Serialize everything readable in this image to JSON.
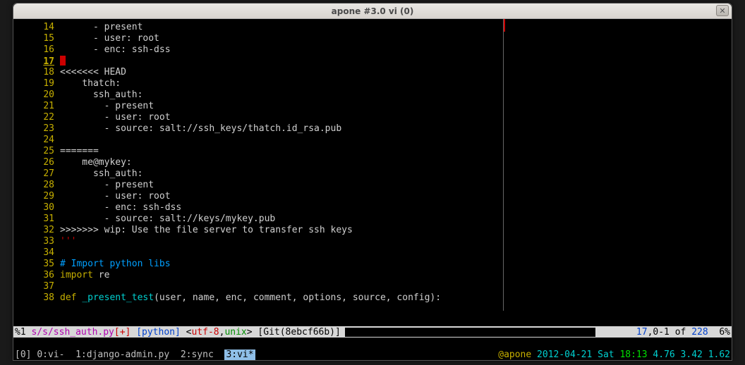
{
  "title": "apone  #3.0  vi (0)",
  "code": {
    "lines": [
      {
        "n": 14,
        "segs": [
          {
            "cls": "txt",
            "t": "      - present"
          }
        ]
      },
      {
        "n": 15,
        "segs": [
          {
            "cls": "txt",
            "t": "      - user: root"
          }
        ]
      },
      {
        "n": 16,
        "segs": [
          {
            "cls": "txt",
            "t": "      - enc: ssh-dss"
          }
        ]
      },
      {
        "n": 17,
        "cursor": true,
        "segs": []
      },
      {
        "n": 18,
        "segs": [
          {
            "cls": "txt",
            "t": "<<<<<<< HEAD"
          }
        ]
      },
      {
        "n": 19,
        "segs": [
          {
            "cls": "txt",
            "t": "    thatch:"
          }
        ]
      },
      {
        "n": 20,
        "segs": [
          {
            "cls": "txt",
            "t": "      ssh_auth:"
          }
        ]
      },
      {
        "n": 21,
        "segs": [
          {
            "cls": "txt",
            "t": "        - present"
          }
        ]
      },
      {
        "n": 22,
        "segs": [
          {
            "cls": "txt",
            "t": "        - user: root"
          }
        ]
      },
      {
        "n": 23,
        "segs": [
          {
            "cls": "txt",
            "t": "        - source: salt://ssh_keys/thatch.id_rsa.pub"
          }
        ]
      },
      {
        "n": 24,
        "segs": []
      },
      {
        "n": 25,
        "segs": [
          {
            "cls": "txt",
            "t": "======="
          }
        ]
      },
      {
        "n": 26,
        "segs": [
          {
            "cls": "txt",
            "t": "    me@mykey:"
          }
        ]
      },
      {
        "n": 27,
        "segs": [
          {
            "cls": "txt",
            "t": "      ssh_auth:"
          }
        ]
      },
      {
        "n": 28,
        "segs": [
          {
            "cls": "txt",
            "t": "        - present"
          }
        ]
      },
      {
        "n": 29,
        "segs": [
          {
            "cls": "txt",
            "t": "        - user: root"
          }
        ]
      },
      {
        "n": 30,
        "segs": [
          {
            "cls": "txt",
            "t": "        - enc: ssh-dss"
          }
        ]
      },
      {
        "n": 31,
        "segs": [
          {
            "cls": "txt",
            "t": "        - source: salt://keys/mykey.pub"
          }
        ]
      },
      {
        "n": 32,
        "segs": [
          {
            "cls": "txt",
            "t": ">>>>>>> wip: Use the file server to transfer ssh keys"
          }
        ]
      },
      {
        "n": 33,
        "segs": [
          {
            "cls": "str",
            "t": "'''"
          }
        ]
      },
      {
        "n": 34,
        "segs": []
      },
      {
        "n": 35,
        "segs": [
          {
            "cls": "cmt",
            "t": "# Import python libs"
          }
        ]
      },
      {
        "n": 36,
        "segs": [
          {
            "cls": "kw",
            "t": "import"
          },
          {
            "cls": "txt",
            "t": " re"
          }
        ]
      },
      {
        "n": 37,
        "segs": []
      },
      {
        "n": 38,
        "segs": [
          {
            "cls": "kw",
            "t": "def "
          },
          {
            "cls": "fn",
            "t": "_present_test"
          },
          {
            "cls": "txt",
            "t": "(user, name, enc, comment, options, source, config):"
          }
        ]
      }
    ]
  },
  "status": {
    "pct": "%1",
    "path": "s/s/ssh_auth.py",
    "modified": "[+]",
    "ftype": "[python]",
    "enc_open": "<",
    "enc_a": "utf-8",
    "enc_sep": ",",
    "enc_b": "unix",
    "enc_close": ">",
    "git": "[Git(8ebcf66b)]",
    "pos_a": "17",
    "pos_b": ",0-1",
    "of": " of ",
    "total": "228",
    "tail": "  6%"
  },
  "tmux": {
    "session": "[0]",
    "w0": "0:vi-",
    "w1": "1:django-admin.py",
    "w2": "2:sync",
    "w3": "3:vi*",
    "host": "@apone",
    "date": "2012-04-21 Sat",
    "time": "18:13",
    "load": "4.76 3.42 1.62"
  }
}
